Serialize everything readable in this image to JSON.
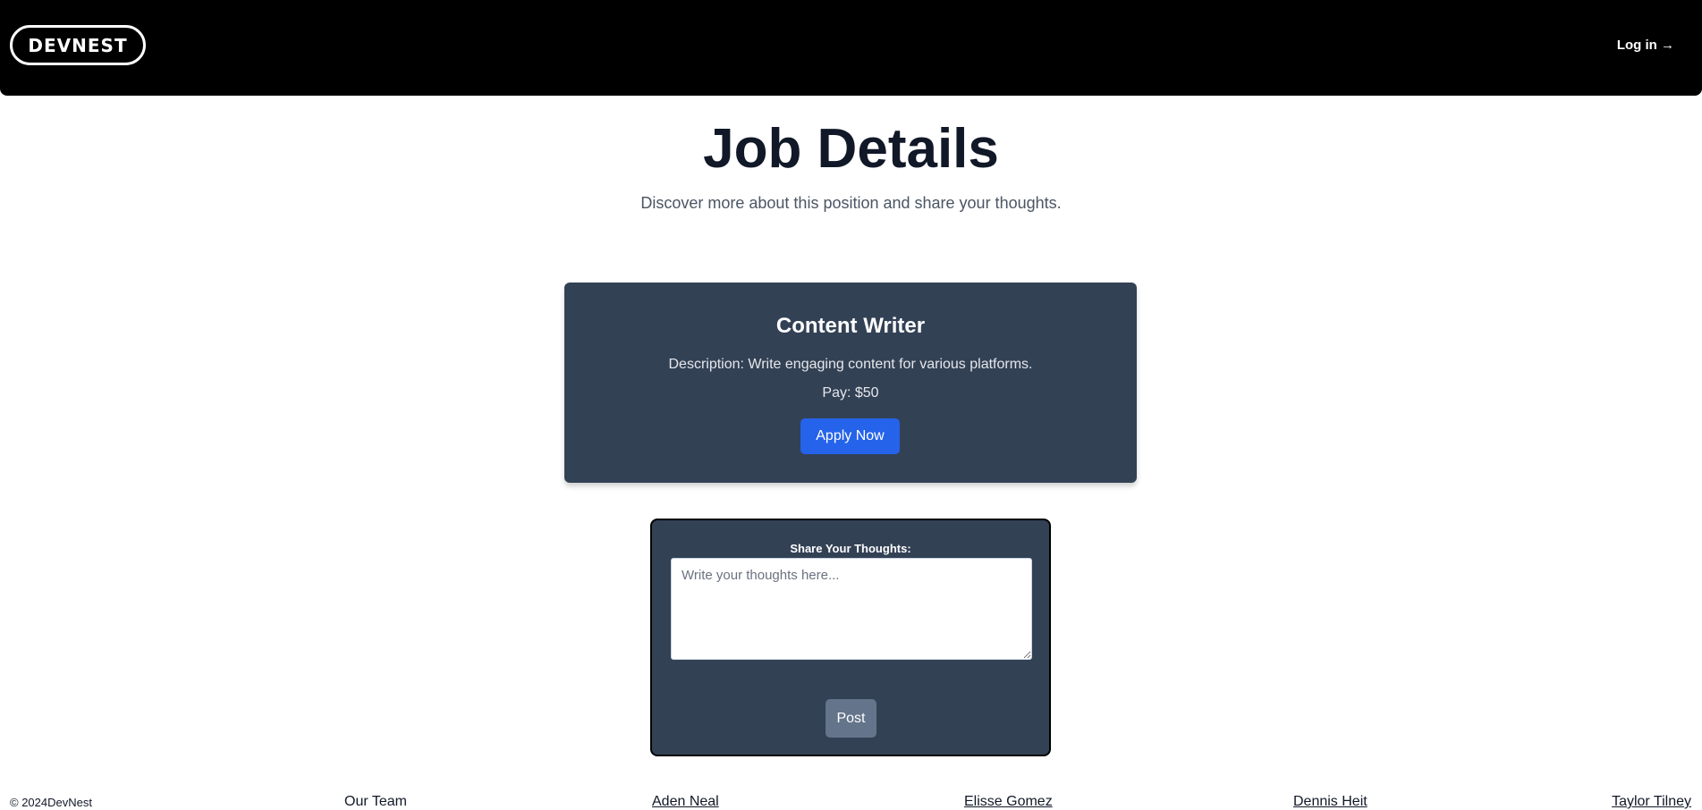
{
  "header": {
    "logo_text": "DEVNEST",
    "login_label": "Log in →"
  },
  "hero": {
    "title": "Job Details",
    "subtitle": "Discover more about this position and share your thoughts."
  },
  "job": {
    "title": "Content Writer",
    "description": "Description: Write engaging content for various platforms.",
    "pay": "Pay: $50",
    "apply_label": "Apply Now"
  },
  "thoughts": {
    "label": "Share Your Thoughts:",
    "placeholder": "Write your thoughts here...",
    "value": "",
    "post_label": "Post"
  },
  "footer": {
    "copyright": "© 2024DevNest",
    "team_label": "Our Team",
    "members": [
      "Aden Neal",
      "Elisse Gomez",
      "Dennis Heit",
      "Taylor Tilney"
    ]
  },
  "colors": {
    "navbar": "#000000",
    "card": "#334155",
    "apply_button": "#2563eb",
    "post_button": "#64748b"
  }
}
